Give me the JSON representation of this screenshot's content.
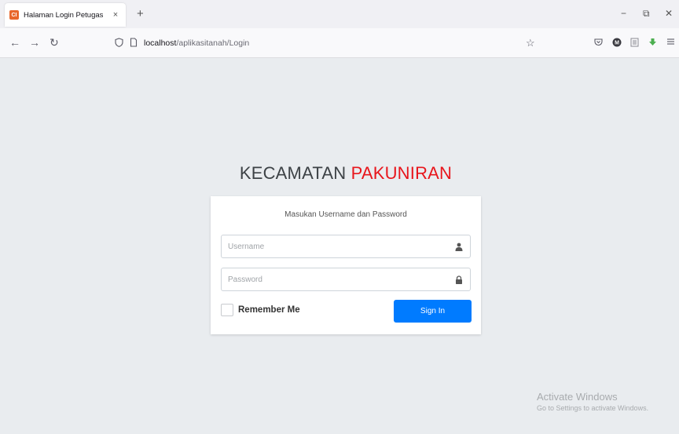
{
  "browser": {
    "tab_title": "Halaman Login Petugas",
    "tab_close": "×",
    "new_tab": "+",
    "favicon_text": "CI",
    "url_host": "localhost",
    "url_path": "/aplikasitanah/Login",
    "window_controls": {
      "minimize": "−",
      "restore": "⧉",
      "close": "✕"
    },
    "nav": {
      "back": "←",
      "forward": "→",
      "reload": "↻"
    },
    "icons": [
      "shield-icon",
      "page-icon",
      "star-icon",
      "pocket-icon",
      "account-icon",
      "reader-icon",
      "download-icon",
      "menu-icon"
    ]
  },
  "page": {
    "brand_main": "KECAMATAN",
    "brand_accent": "PAKUNIRAN",
    "brand_accent_color": "#e8161c",
    "login_message": "Masukan Username dan Password",
    "username_placeholder": "Username",
    "password_placeholder": "Password",
    "remember_label": "Remember Me",
    "signin_label": "Sign In",
    "signin_color": "#007bff"
  },
  "watermark": {
    "title": "Activate Windows",
    "subtitle": "Go to Settings to activate Windows."
  }
}
